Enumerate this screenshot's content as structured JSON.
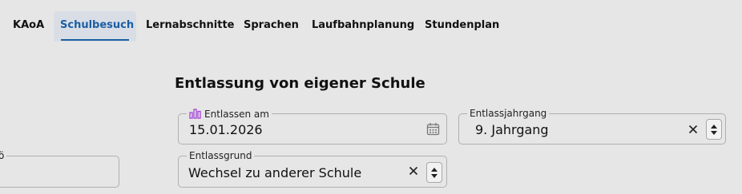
{
  "tabs": [
    {
      "label": "KAoA",
      "active": false
    },
    {
      "label": "Schulbesuch",
      "active": true
    },
    {
      "label": "Lernabschnitte",
      "active": false
    },
    {
      "label": "Sprachen",
      "active": false
    },
    {
      "label": "Laufbahnplanung",
      "active": false
    },
    {
      "label": "Stundenplan",
      "active": false
    }
  ],
  "section": {
    "title": "Entlassung von eigener Schule"
  },
  "fields": {
    "entlassen_am": {
      "label": "Entlassen am",
      "value": "15.01.2026",
      "label_icon": "bar-chart-icon",
      "trailing_icon": "calendar-icon"
    },
    "entlassjahrgang": {
      "label": "Entlassjahrgang",
      "value": "9. Jahrgang"
    },
    "entlassgrund": {
      "label": "Entlassgrund",
      "value": "Wechsel zu anderer Schule"
    },
    "left_partial": {
      "label": "ö"
    }
  },
  "colors": {
    "accent": "#1c5ea3",
    "icon_purple": "#a344d6",
    "background": "#e6e6e6"
  }
}
